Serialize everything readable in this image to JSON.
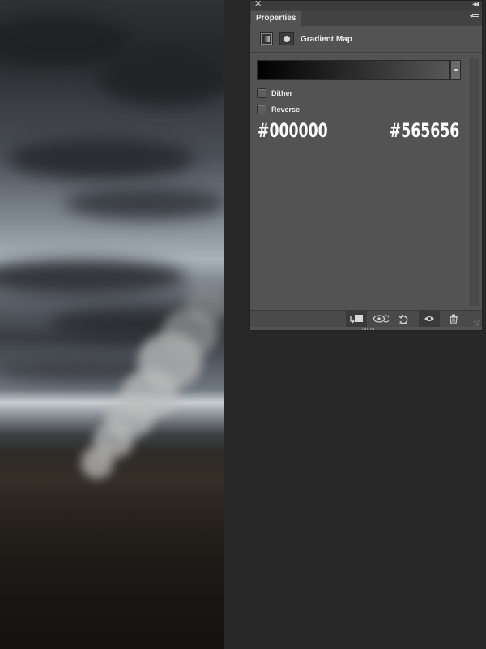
{
  "panel": {
    "tab_label": "Properties",
    "adjustment_title": "Gradient Map"
  },
  "gradient": {
    "start_color": "#000000",
    "end_color": "#565656"
  },
  "options": [
    {
      "label": "Dither",
      "checked": false
    },
    {
      "label": "Reverse",
      "checked": false
    }
  ],
  "color_labels": {
    "left": "#000000",
    "right": "#565656"
  },
  "footer_icons": [
    "clip-to-layer-icon",
    "view-previous-state-icon",
    "reset-adjustment-icon",
    "visibility-eye-icon",
    "trash-icon"
  ]
}
